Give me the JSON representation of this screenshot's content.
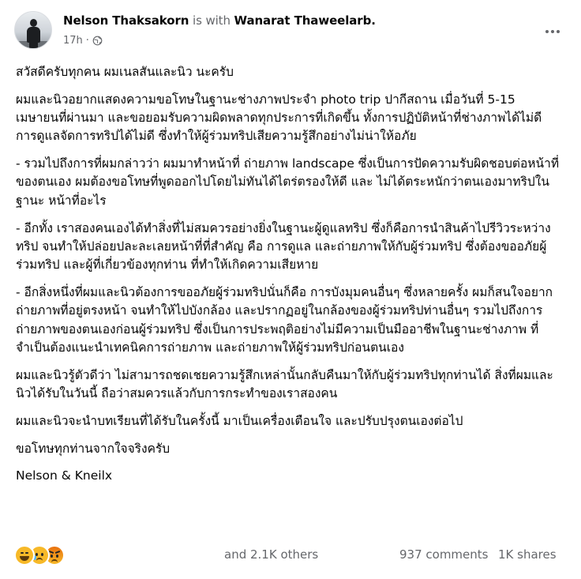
{
  "post": {
    "author": "Nelson Thaksakorn",
    "with_text": "is with",
    "tagged": "Wanarat Thaweelarb.",
    "time": "17h",
    "privacy_icon": "globe-icon",
    "more_icon": "more-horizontal-icon"
  },
  "content": {
    "paragraphs": [
      "สวัสดีครับทุกคน ผมเนลสันและนิว นะครับ",
      "ผมและนิวอยากแสดงความขอโทษในฐานะช่างภาพประจำ photo trip ปากีสถาน เมื่อวันที่ 5-15 เมษายนที่ผ่านมา และขอยอมรับความผิดพลาดทุกประการที่เกิดขึ้น ทั้งการปฏิบัติหน้าที่ช่างภาพได้ไม่ดี การดูแลจัดการทริปได้ไม่ดี ซึ่งทำให้ผู้ร่วมทริปเสียความรู้สึกอย่างไม่น่าให้อภัย",
      "- รวมไปถึงการที่ผมกล่าวว่า ผมมาทำหน้าที่ ถ่ายภาพ landscape ซึ่งเป็นการปัดความรับผิดชอบต่อหน้าที่ของตนเอง ผมต้องขอโทษที่พูดออกไปโดยไม่ทันได้ไตร่ตรองให้ดี และ ไม่ได้ตระหนักว่าตนเองมาทริปในฐานะ หน้าที่อะไร",
      "- อีกทั้ง เราสองคนเองได้ทำสิ่งที่ไม่สมควรอย่างยิ่งในฐานะผู้ดูแลทริป ซึ่งก็คือการนำสินค้าไปรีวิวระหว่างทริป จนทำให้ปล่อยปละละเลยหน้าที่ที่สำคัญ คือ การดูแล และถ่ายภาพให้กับผู้ร่วมทริป ซึ่งต้องขออภัยผู้ร่วมทริป และผู้ที่เกี่ยวข้องทุกท่าน ที่ทำให้เกิดความเสียหาย",
      "- อีกสิ่งหนึ่งที่ผมและนิวต้องการขออภัยผู้ร่วมทริปนั่นก็คือ การบังมุมคนอื่นๆ ซึ่งหลายครั้ง ผมก็สนใจอยากถ่ายภาพที่อยู่ตรงหน้า จนทำให้ไปบังกล้อง และปรากฏอยู่ในกล้องของผู้ร่วมทริปท่านอื่นๆ รวมไปถึงการถ่ายภาพของตนเองก่อนผู้ร่วมทริป ซึ่งเป็นการประพฤติอย่างไม่มีความเป็นมืออาชีพในฐานะช่างภาพ ที่จำเป็นต้องแนะนำเทคนิคการถ่ายภาพ และถ่ายภาพให้ผู้ร่วมทริปก่อนตนเอง",
      "ผมและนิวรู้ตัวดีว่า ไม่สามารถชดเชยความรู้สึกเหล่านั้นกลับคืนมาให้กับผู้ร่วมทริปทุกท่านได้ สิ่งที่ผมและนิวได้รับในวันนี้ ถือว่าสมควรแล้วกับการกระทำของเราสองคน",
      "ผมและนิวจะนำบทเรียนที่ได้รับในครั้งนี้ มาเป็นเครื่องเตือนใจ และปรับปรุงตนเองต่อไป",
      "ขอโทษทุกท่านจากใจจริงครับ",
      "Nelson & Kneilx"
    ]
  },
  "footer": {
    "reactions": [
      "haha-reaction-icon",
      "sad-reaction-icon",
      "angry-reaction-icon"
    ],
    "reacted_text": "and 2.1K others",
    "comments": "937 comments",
    "shares": "1K shares"
  },
  "colors": {
    "text": "#050505",
    "secondary": "#65676b",
    "reaction_yellow": "#f7b928",
    "reaction_orange": "#e9710f"
  }
}
